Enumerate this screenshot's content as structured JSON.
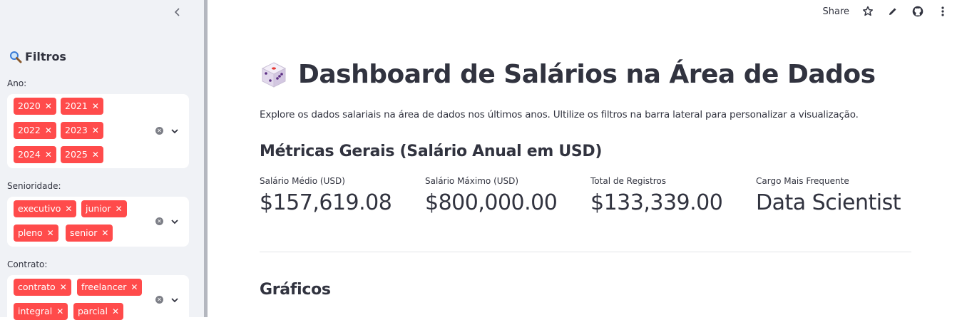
{
  "sidebar": {
    "title": "Filtros",
    "filters": [
      {
        "label": "Ano:",
        "tags": [
          "2020",
          "2021",
          "2022",
          "2023",
          "2024",
          "2025"
        ]
      },
      {
        "label": "Senioridade:",
        "tags": [
          "executivo",
          "junior",
          "pleno",
          "senior"
        ]
      },
      {
        "label": "Contrato:",
        "tags": [
          "contrato",
          "freelancer",
          "integral",
          "parcial"
        ]
      }
    ]
  },
  "topbar": {
    "share_label": "Share"
  },
  "main": {
    "title": "Dashboard de Salários na Área de Dados",
    "subtitle": "Explore os dados salariais na área de dados nos últimos anos. Ultilize os filtros na barra lateral para personalizar a visualização.",
    "metrics_heading": "Métricas Gerais (Salário Anual em USD)",
    "metrics": [
      {
        "label": "Salário Médio (USD)",
        "value": "$157,619.08"
      },
      {
        "label": "Salário Máximo (USD)",
        "value": "$800,000.00"
      },
      {
        "label": "Total de Registros",
        "value": "$133,339.00"
      },
      {
        "label": "Cargo Mais Frequente",
        "value": "Data Scientist"
      }
    ],
    "graphs_heading": "Gráficos"
  },
  "icons": {
    "collapse": "chevron-left-icon",
    "search": "magnifier-icon",
    "title_emoji": "die-icon",
    "share_actions": [
      "star-icon",
      "pencil-icon",
      "github-icon",
      "more-vertical-icon"
    ]
  },
  "colors": {
    "accent": "#ff4b4b",
    "sidebar_bg": "#f0f2f6",
    "text": "#31333f"
  }
}
